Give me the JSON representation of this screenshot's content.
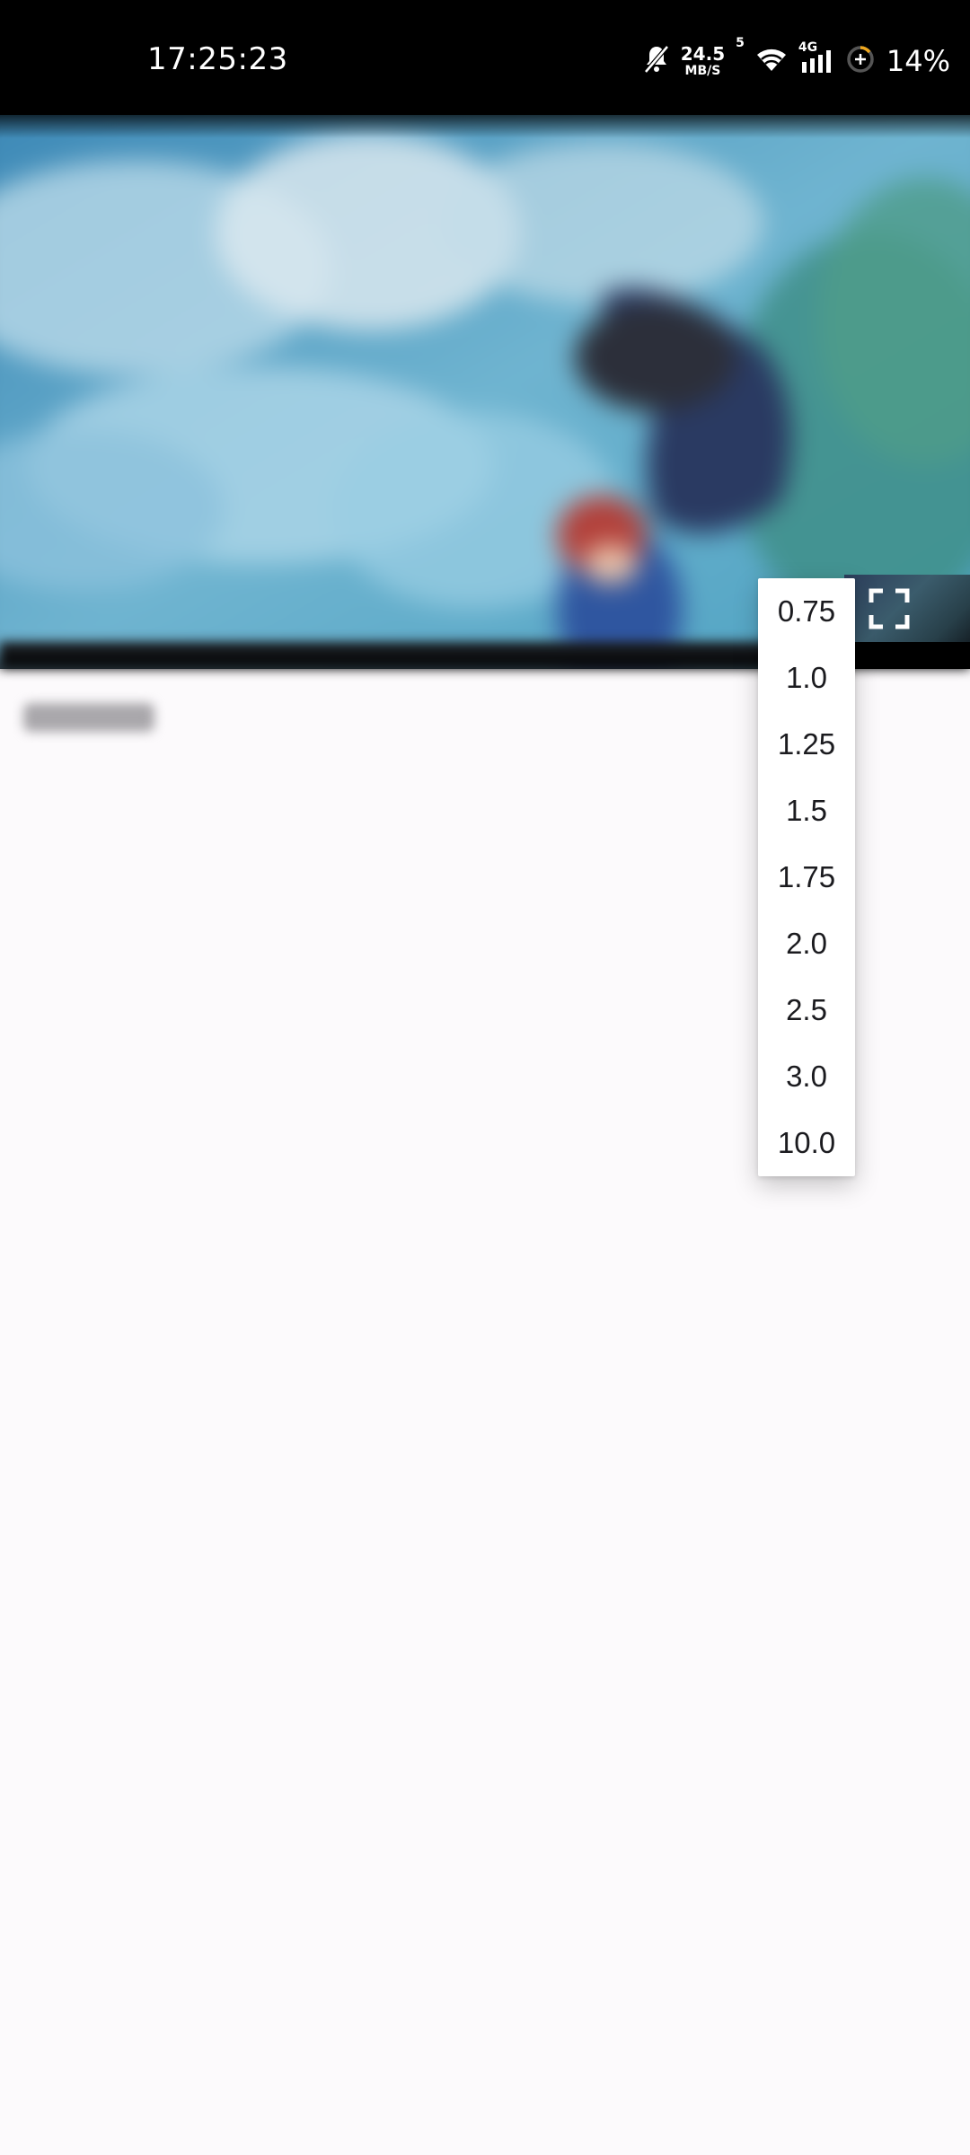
{
  "status_bar": {
    "time": "17:25:23",
    "net_speed_value": "24.5",
    "net_speed_unit": "MB/S",
    "sim_label": "5",
    "network_type": "4G",
    "battery": "14%",
    "icons": [
      "mute-bell-icon",
      "wifi-icon",
      "cellular-signal-icon",
      "battery-ring-icon"
    ]
  },
  "player": {
    "icons": [
      "fullscreen-icon"
    ]
  },
  "speed_menu": {
    "options": [
      "0.75",
      "1.0",
      "1.25",
      "1.5",
      "1.75",
      "2.0",
      "2.5",
      "3.0",
      "10.0"
    ]
  },
  "colors": {
    "page_background": "#fcfafc",
    "status_bar": "#000000",
    "menu_background": "#ffffff",
    "menu_text": "#1b1b1f"
  }
}
